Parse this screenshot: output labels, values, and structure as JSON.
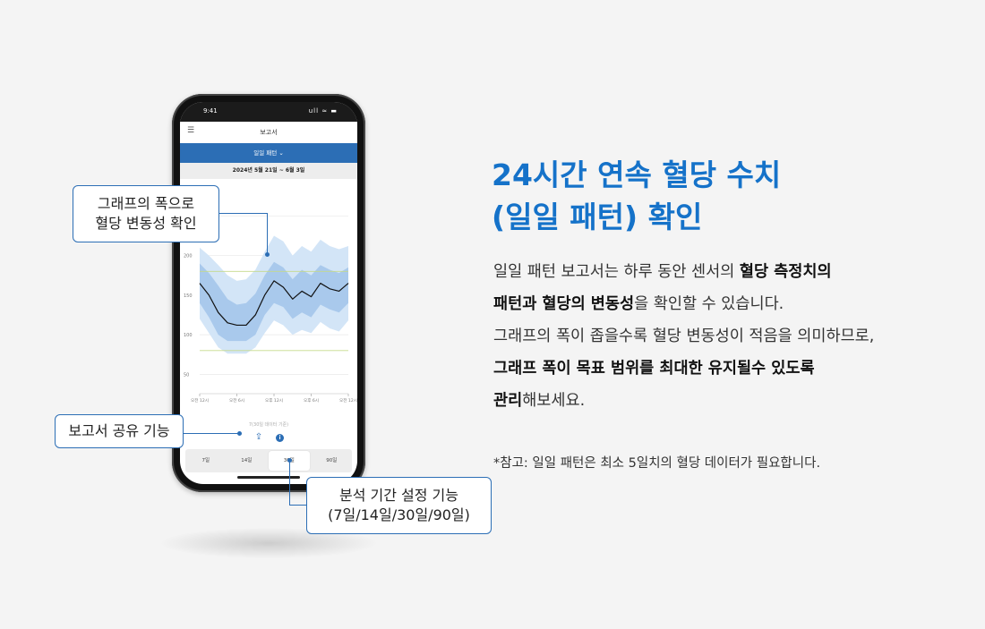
{
  "phone": {
    "status_time": "9:41",
    "status_icons": "ull ≈ ▬",
    "app_title": "보고서",
    "tab_label": "일일 패턴",
    "date_range": "2024년 5월 21일 ~ 6월 3일",
    "chart_note": "7(30일 데이터 기준)",
    "period_tabs": [
      "7일",
      "14일",
      "30일",
      "90일"
    ],
    "active_period": "30일"
  },
  "chart_data": {
    "type": "area",
    "y_ticks": [
      250,
      200,
      150,
      100,
      50
    ],
    "x_ticks": [
      "오전 12시",
      "오전 6시",
      "오후 12시",
      "오후 6시",
      "오전 12시"
    ],
    "ylim": [
      30,
      290
    ],
    "target_range": [
      80,
      180
    ],
    "x": [
      0,
      1.5,
      3,
      4.5,
      6,
      7.5,
      9,
      10.5,
      12,
      13.5,
      15,
      16.5,
      18,
      19.5,
      21,
      22.5,
      24
    ],
    "series": [
      {
        "values": [
          165,
          150,
          128,
          115,
          112,
          112,
          125,
          150,
          168,
          160,
          145,
          155,
          148,
          165,
          158,
          155,
          165
        ]
      }
    ],
    "band_inner": {
      "upper": [
        190,
        178,
        162,
        145,
        138,
        140,
        152,
        175,
        192,
        185,
        170,
        182,
        175,
        188,
        182,
        178,
        185
      ],
      "lower": [
        140,
        122,
        100,
        92,
        92,
        92,
        100,
        125,
        140,
        135,
        120,
        128,
        122,
        138,
        132,
        128,
        140
      ]
    },
    "band_outer": {
      "upper": [
        210,
        200,
        188,
        175,
        168,
        170,
        182,
        205,
        225,
        218,
        200,
        212,
        205,
        220,
        212,
        208,
        212
      ],
      "lower": [
        120,
        102,
        84,
        76,
        76,
        76,
        84,
        102,
        118,
        112,
        100,
        106,
        102,
        116,
        108,
        104,
        118
      ]
    },
    "colors": {
      "outer": "#d3e5f7",
      "inner": "#a9c9ec",
      "median": "#111111",
      "target": "#c5d98a"
    }
  },
  "callouts": {
    "chart_width": [
      "그래프의 폭으로",
      "혈당 변동성 확인"
    ],
    "share": "보고서 공유 기능",
    "period": [
      "분석 기간 설정 기능",
      "(7일/14일/30일/90일)"
    ]
  },
  "headline": [
    "24시간 연속 혈당 수치",
    "(일일 패턴) 확인"
  ],
  "body": {
    "p1a": "일일 패턴 보고서는 하루 동안 센서의 ",
    "p1b": "혈당 측정치의",
    "p1c": "패턴과 혈당의 변동성",
    "p1d": "을 확인할 수 있습니다.",
    "p2": "그래프의 폭이 좁을수록 혈당 변동성이 적음을 의미하므로,",
    "p3": "그래프 폭이 목표 범위를 최대한 유지될수 있도록",
    "p4a": "관리",
    "p4b": "해보세요."
  },
  "footnote": "*참고: 일일 패턴은 최소 5일치의 혈당 데이터가 필요합니다.",
  "accent": "#2c6eb5"
}
